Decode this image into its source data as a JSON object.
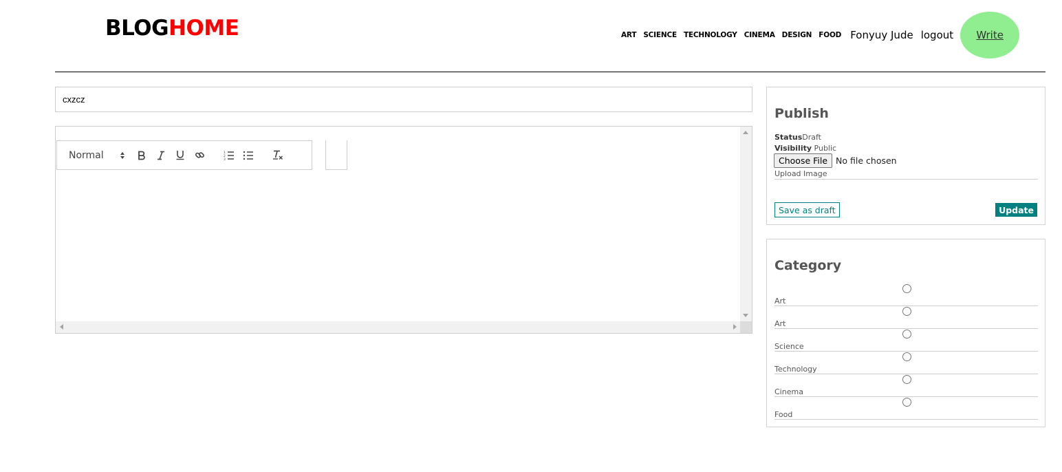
{
  "header": {
    "logo_part1": "BLOG",
    "logo_part2": "HOME",
    "nav_links": [
      "ART",
      "SCIENCE",
      "TECHNOLOGY",
      "CINEMA",
      "DESIGN",
      "FOOD"
    ],
    "user_name": "Fonyuy Jude",
    "logout_label": "logout",
    "write_label": "Write",
    "colors": {
      "logo_accent": "#ff0000",
      "write_bg": "#90ee90"
    }
  },
  "editor": {
    "title_value": "cxzcz",
    "format_select": "Normal",
    "toolbar_icons": [
      "bold-icon",
      "italic-icon",
      "underline-icon",
      "link-icon",
      "ordered-list-icon",
      "bullet-list-icon",
      "clear-format-icon"
    ]
  },
  "publish": {
    "heading": "Publish",
    "status_label": "Status",
    "status_value": "Draft",
    "visibility_label": "Visibility",
    "visibility_value": "Public",
    "choose_file_label": "Choose File",
    "no_file_label": "No file chosen",
    "upload_label": "Upload Image",
    "save_draft_label": "Save as draft",
    "update_label": "Update",
    "colors": {
      "accent": "#008080"
    }
  },
  "category": {
    "heading": "Category",
    "items": [
      "Art",
      "Art",
      "Science",
      "Technology",
      "Cinema",
      "Food"
    ]
  }
}
